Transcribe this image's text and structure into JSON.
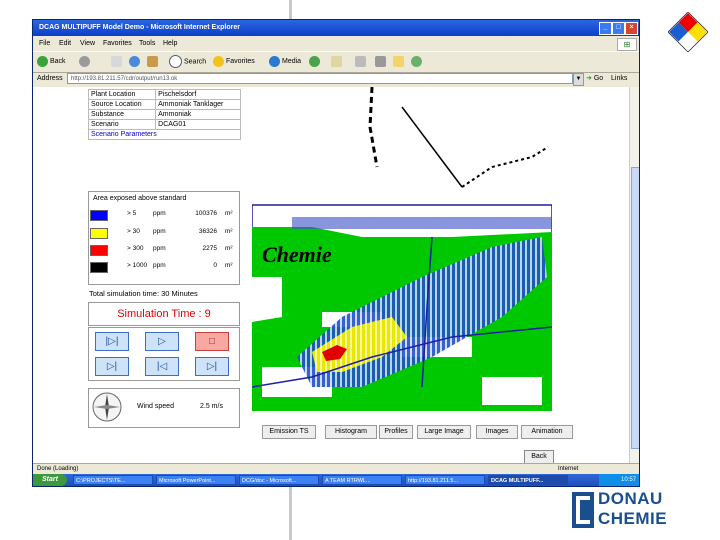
{
  "window": {
    "title": "DCAG MULTIPUFF Model Demo - Microsoft Internet Explorer",
    "menu": [
      "File",
      "Edit",
      "View",
      "Favorites",
      "Tools",
      "Help"
    ],
    "toolbar": {
      "back": "Back",
      "search": "Search",
      "favorites": "Favorites",
      "media": "Media"
    },
    "address_label": "Address",
    "address_value": "http://193.81.211.57/cdr/output/run13.ok",
    "go_label": "Go",
    "links_label": "Links",
    "status_text": "Done (Loading)",
    "status_zone": "Internet"
  },
  "info_table": [
    {
      "label": "Plant Location",
      "value": "Pischelsdorf"
    },
    {
      "label": "Source Location",
      "value": "Ammoniak Tanklager"
    },
    {
      "label": "Substance",
      "value": "Ammoniak"
    },
    {
      "label": "Scenario",
      "value": "DCAG01"
    }
  ],
  "scenario_parameters_link": "Scenario Parameters",
  "area": {
    "title": "Area exposed above standard",
    "rows": [
      {
        "color": "#0000ff",
        "threshold": "> 5",
        "unit": "ppm",
        "value": "100376",
        "area_unit": "m²"
      },
      {
        "color": "#ffff00",
        "threshold": "> 30",
        "unit": "ppm",
        "value": "36326",
        "area_unit": "m²"
      },
      {
        "color": "#ff0000",
        "threshold": "> 300",
        "unit": "ppm",
        "value": "2275",
        "area_unit": "m²"
      },
      {
        "color": "#000000",
        "threshold": "> 1000",
        "unit": "ppm",
        "value": "0",
        "area_unit": "m²"
      }
    ]
  },
  "total_sim_time": "Total simulation time: 30 Minutes",
  "simulation_time": "Simulation Time : 9",
  "controls": [
    "|▷|",
    "▷",
    "□",
    "▷|",
    "|◁",
    "▷|"
  ],
  "wind": {
    "label": "Wind speed",
    "value": "2.5 m/s"
  },
  "map": {
    "text_chemie": "Chemie"
  },
  "tabs": [
    "Emission TS",
    "Histogram",
    "Profiles",
    "Large Image",
    "Images",
    "Animation"
  ],
  "back_button": "Back",
  "taskbar": {
    "start": "Start",
    "tasks": [
      "C:\\PROJECTS\\TE...",
      "Microsoft PowerPoint...",
      "DCG/doc - Microsoft...",
      "A TEAM RTRWL...",
      "http://193.81.211.5...",
      "DCAG MULTIPUFF..."
    ],
    "clock": "10:57"
  },
  "logo": {
    "line1": "DONAU",
    "line2": "CHEMIE"
  },
  "colors": {
    "accent": "#1a4f8f",
    "titlebar": "#0a3ec8",
    "map_green": "#00c800",
    "plume_blue": "#1e50c8"
  }
}
